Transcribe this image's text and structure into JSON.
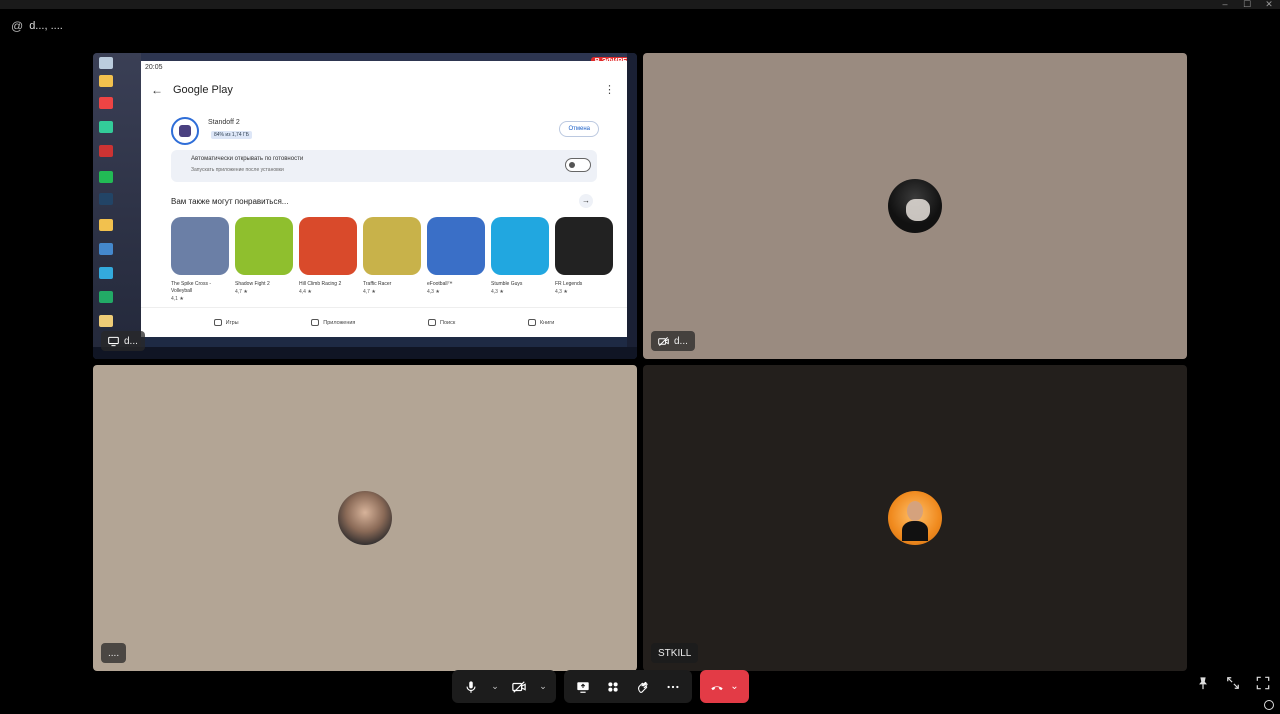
{
  "call": {
    "title": "d..., ...."
  },
  "tiles": {
    "screen_share": {
      "name": "d...",
      "live_badge": "В ЭФИРЕ",
      "phone_time": "20:05",
      "store_title": "Google Play",
      "app": {
        "name": "Standoff 2",
        "progress": "84% из 1,74 ГБ",
        "cancel_label": "Отмена"
      },
      "auto_open": {
        "title": "Автоматически открывать по готовности",
        "subtitle": "Запускать приложение после установки"
      },
      "recs_title": "Вам также могут понравиться...",
      "games": [
        {
          "name": "The Spike Cross - Volleyball",
          "rating": "4,1 ★",
          "color": "#6b7fa6"
        },
        {
          "name": "Shadow Fight 2",
          "rating": "4,7 ★",
          "color": "#8fbf2e"
        },
        {
          "name": "Hill Climb Racing 2",
          "rating": "4,4 ★",
          "color": "#d94a2b"
        },
        {
          "name": "Traffic Racer",
          "rating": "4,7 ★",
          "color": "#c8b24a"
        },
        {
          "name": "eFootball™",
          "rating": "4,3 ★",
          "color": "#3a6fc7"
        },
        {
          "name": "Stumble Guys",
          "rating": "4,3 ★",
          "color": "#21a7e0"
        },
        {
          "name": "FR Legends",
          "rating": "4,3 ★",
          "color": "#222222"
        }
      ],
      "nav": [
        "Игры",
        "Приложения",
        "Поиск",
        "Книги"
      ]
    },
    "participant_2": {
      "name": "d..."
    },
    "participant_3": {
      "name": "...."
    },
    "participant_4": {
      "name": "STKILL"
    }
  },
  "colors": {
    "end_call": "#e33b46",
    "tile_2": "#9a8b80",
    "tile_3": "#b3a595",
    "tile_4": "#231f1c"
  },
  "icons": [
    "mic-icon",
    "camera-off-icon",
    "screen-share-icon",
    "layout-icon",
    "reactions-icon",
    "more-icon",
    "hangup-icon",
    "pin-icon",
    "pip-icon",
    "fullscreen-icon"
  ]
}
